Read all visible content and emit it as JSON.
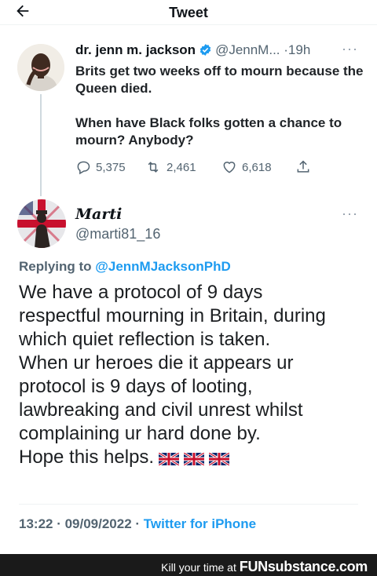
{
  "header": {
    "title": "Tweet"
  },
  "original_tweet": {
    "author_name": "dr. jenn m. jackson",
    "handle": "@JennM...",
    "separator": "·",
    "time": "19h",
    "more": "···",
    "paragraphs": [
      "Brits get two weeks off to mourn because the Queen died.",
      "When have Black folks gotten a chance to mourn? Anybody?"
    ],
    "stats": {
      "replies": "5,375",
      "retweets": "2,461",
      "likes": "6,618"
    }
  },
  "reply_tweet": {
    "author_name": "Marti",
    "handle": "@marti81_16",
    "more": "···",
    "replying_prefix": "Replying to",
    "replying_to": "@JennMJacksonPhD",
    "lines": [
      "We have a protocol of 9 days",
      "respectful mourning in Britain, during",
      "which quiet reflection is taken.",
      "When ur heroes die it appears ur",
      "protocol is 9 days of looting,",
      "lawbreaking and civil unrest whilst",
      "complaining ur hard done by.",
      "Hope this helps."
    ],
    "flag_icons": [
      "uk-flag-icon",
      "uk-flag-icon",
      "uk-flag-icon"
    ],
    "timestamp": "13:22 · 09/09/2022 ·",
    "source": "Twitter for iPhone"
  },
  "watermark": {
    "text": "Kill your time at",
    "brand_a": "FUN",
    "brand_b": "substance",
    "brand_c": ".com"
  },
  "colors": {
    "accent": "#1d9bf0",
    "secondary_text": "#536471"
  }
}
